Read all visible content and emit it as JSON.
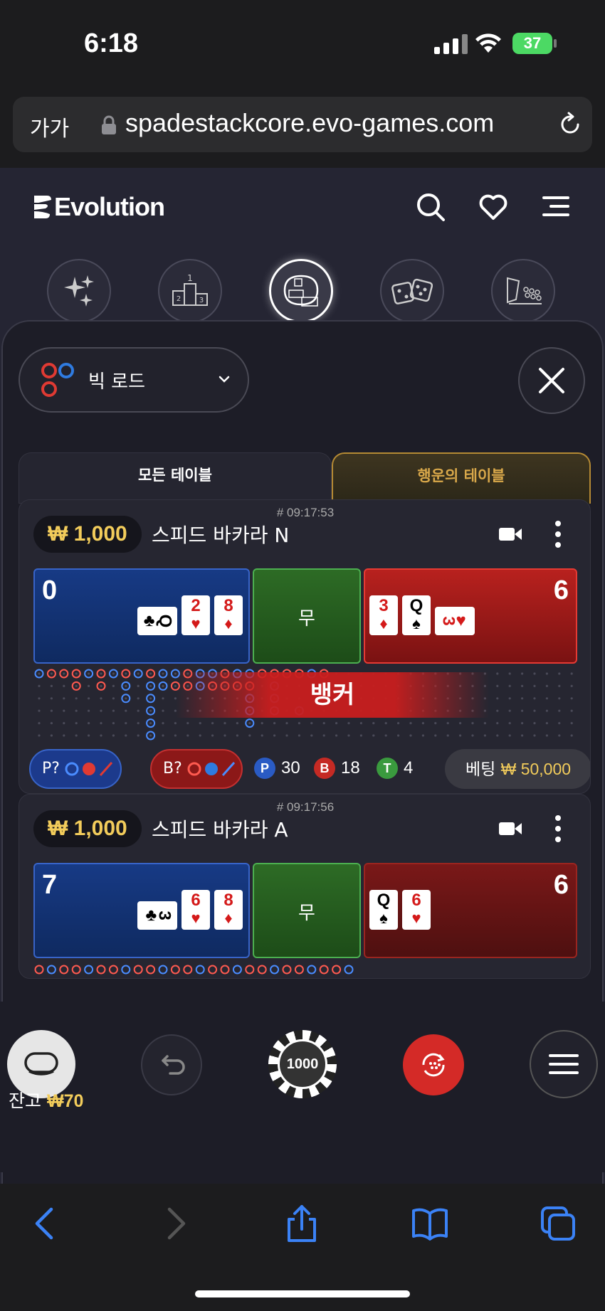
{
  "status_bar": {
    "time": "6:18",
    "battery": "37"
  },
  "browser": {
    "text_size_label": "가가",
    "url": "spadestackcore.evo-games.com"
  },
  "app": {
    "brand": "Evolution",
    "road_selector": {
      "label": "빅 로드"
    },
    "tabs": {
      "all": "모든 테이블",
      "lucky": "행운의 테이블"
    },
    "tables": [
      {
        "time": "# 09:17:53",
        "limit": "₩ 1,000",
        "name": "스피드 바카라 N",
        "player_score": "0",
        "tie_label": "무",
        "banker_score": "6",
        "player_cards": [
          {
            "rank": "Q",
            "suit": "♣",
            "color": "black",
            "side": true
          },
          {
            "rank": "2",
            "suit": "♥",
            "color": "red"
          },
          {
            "rank": "8",
            "suit": "♦",
            "color": "red"
          }
        ],
        "banker_cards": [
          {
            "rank": "3",
            "suit": "♦",
            "color": "red"
          },
          {
            "rank": "Q",
            "suit": "♠",
            "color": "black"
          },
          {
            "rank": "3",
            "suit": "♥",
            "color": "red",
            "side": true
          }
        ],
        "winner": "뱅커",
        "player_prediction": "P?",
        "banker_prediction": "B?",
        "stats": {
          "p_label": "P",
          "p": "30",
          "b_label": "B",
          "b": "18",
          "t_label": "T",
          "t": "4"
        },
        "bet_label": "베팅",
        "bet_amount": "₩ 50,000"
      },
      {
        "time": "# 09:17:56",
        "limit": "₩ 1,000",
        "name": "스피드 바카라 A",
        "player_score": "7",
        "tie_label": "무",
        "banker_score": "6",
        "player_cards": [
          {
            "rank": "3",
            "suit": "♣",
            "color": "black",
            "side": true
          },
          {
            "rank": "6",
            "suit": "♥",
            "color": "red"
          },
          {
            "rank": "8",
            "suit": "♦",
            "color": "red"
          }
        ],
        "banker_cards": [
          {
            "rank": "Q",
            "suit": "♠",
            "color": "black"
          },
          {
            "rank": "6",
            "suit": "♥",
            "color": "red"
          }
        ]
      }
    ],
    "chip": {
      "value": "1000"
    },
    "balance": {
      "label": "잔고",
      "amount": "₩70"
    }
  },
  "colors": {
    "gold": "#f2cc5b",
    "player_blue": "#3864c8",
    "banker_red": "#e63a33",
    "tie_green": "#4caf50"
  }
}
